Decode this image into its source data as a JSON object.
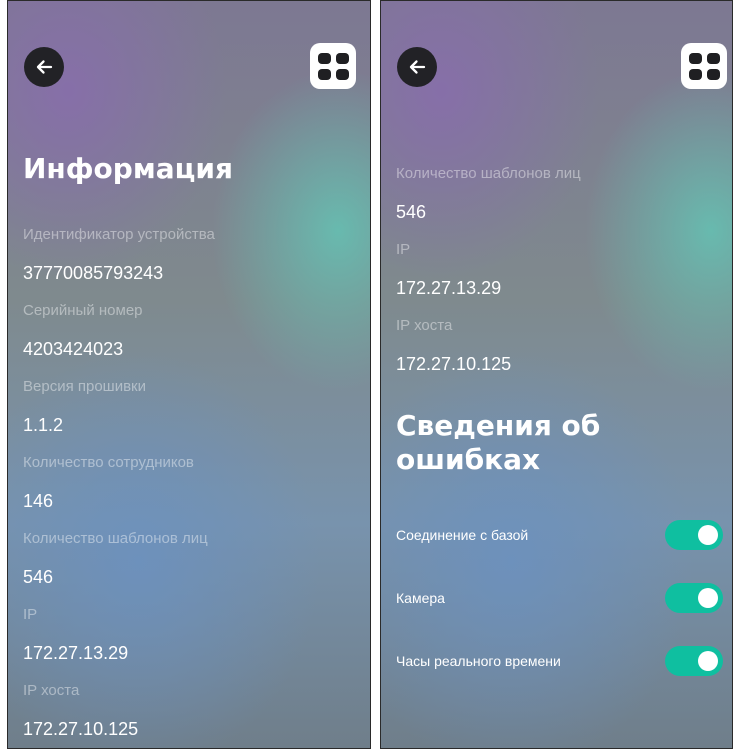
{
  "info": {
    "title": "Информация",
    "fields": [
      {
        "label": "Идентификатор устройства",
        "value": "37770085793243"
      },
      {
        "label": "Серийный номер",
        "value": "4203424023"
      },
      {
        "label": "Версия прошивки",
        "value": "1.1.2"
      },
      {
        "label": "Количество сотрудников",
        "value": "146"
      },
      {
        "label": "Количество шаблонов лиц",
        "value": "546"
      },
      {
        "label": "IP",
        "value": "172.27.13.29"
      },
      {
        "label": "IP хоста",
        "value": "172.27.10.125"
      }
    ]
  },
  "errors": {
    "title_line1": "Сведения об",
    "title_line2": "ошибках",
    "items": [
      {
        "label": "Соединение с базой",
        "enabled": true
      },
      {
        "label": "Камера",
        "enabled": true
      },
      {
        "label": "Часы реального времени",
        "enabled": true
      }
    ]
  },
  "icons": {
    "back": "arrow-left-icon",
    "menu": "grid-icon"
  },
  "colors": {
    "toggle_on": "#0fbfa0",
    "back_button": "#222226"
  }
}
